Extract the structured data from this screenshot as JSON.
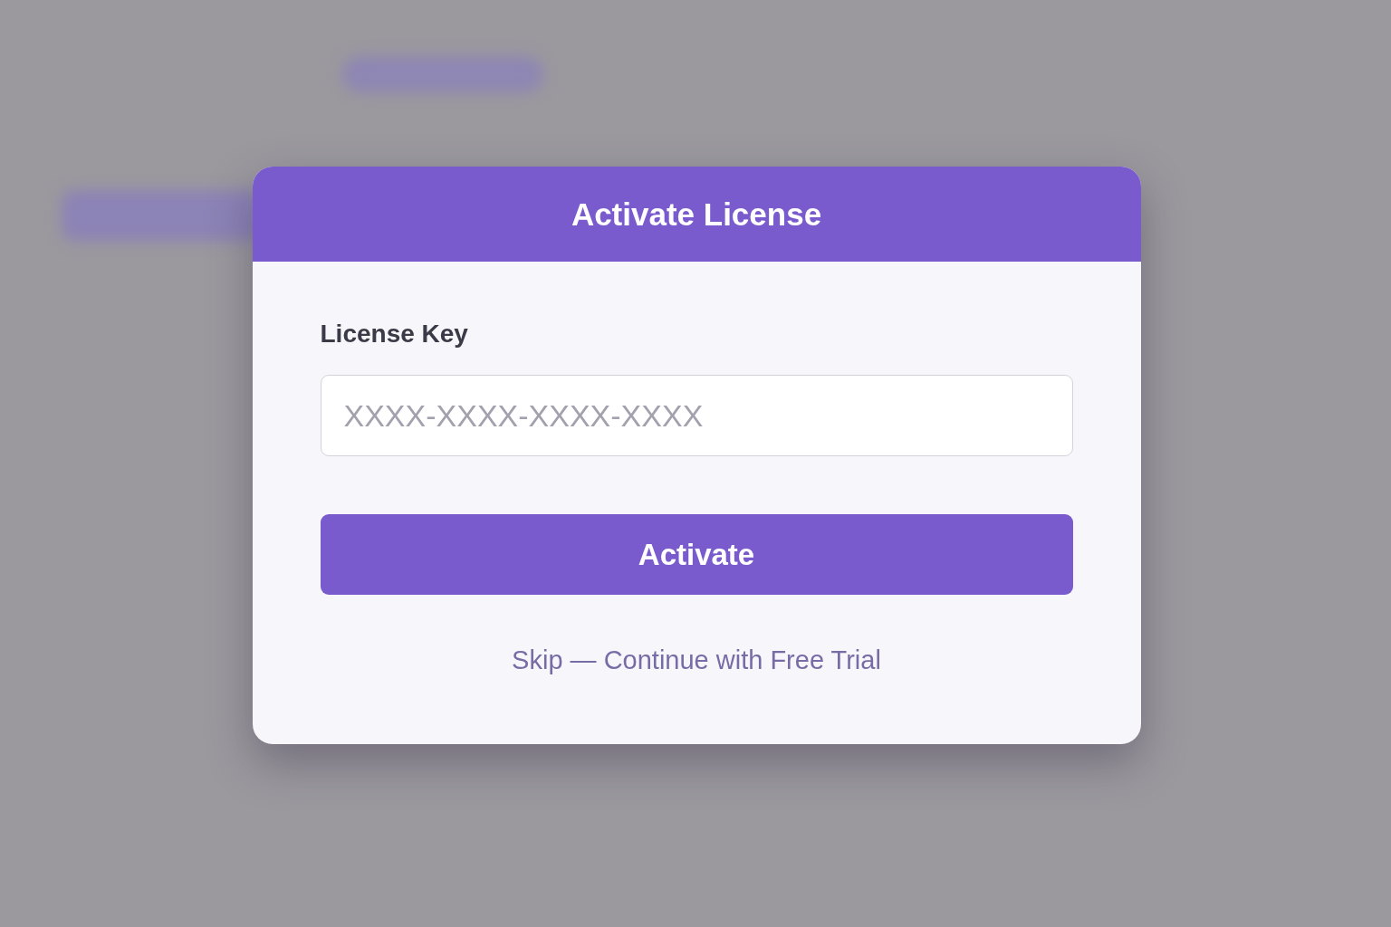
{
  "dialog": {
    "title": "Activate License",
    "field": {
      "label": "License Key",
      "placeholder": "XXXX-XXXX-XXXX-XXXX"
    },
    "primary_button": "Activate",
    "skip_link": "Skip — Continue with Free Trial"
  }
}
